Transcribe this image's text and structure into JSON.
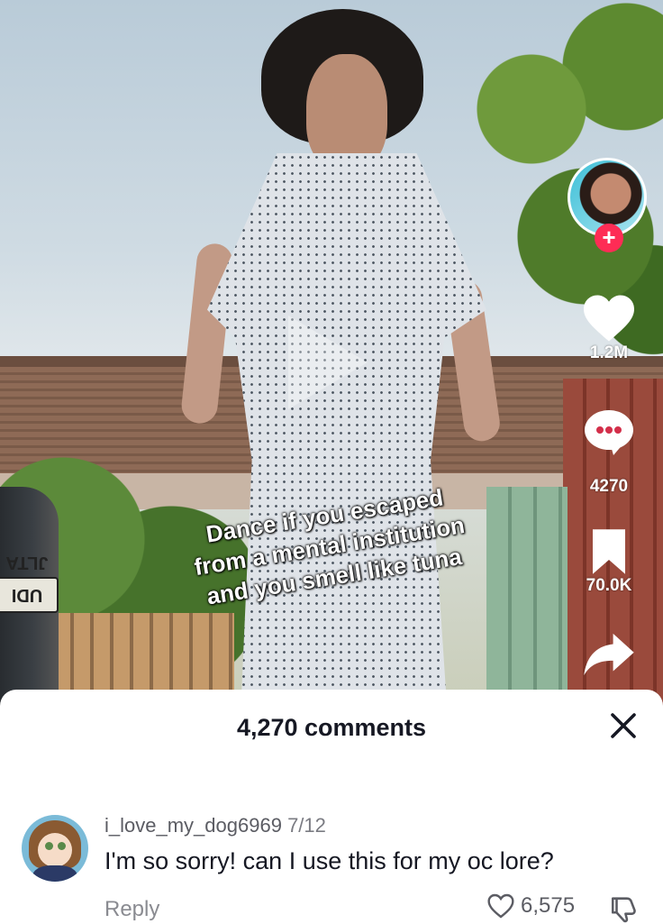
{
  "video": {
    "caption_lines": [
      "Dance if you escaped",
      "from a mental institution",
      "and you smell like tuna"
    ],
    "license_plate": "UDI JLTA",
    "icons": [
      "play-icon"
    ]
  },
  "actions": {
    "follow_label": "+",
    "likes": "1.2M",
    "comments": "4270",
    "bookmarks": "70.0K",
    "icons": [
      "heart-icon",
      "comment-icon",
      "bookmark-icon",
      "share-icon"
    ]
  },
  "comments_sheet": {
    "title": "4,270 comments",
    "close_label": "✕",
    "comment": {
      "username": "i_love_my_dog6969",
      "date": "7/12",
      "text": "I'm so sorry! can I use this for my oc lore?",
      "reply_label": "Reply",
      "like_count": "6,575"
    }
  },
  "colors": {
    "accent": "#fe2c55",
    "sheet_background": "#ffffff",
    "text_primary": "#161823",
    "text_secondary": "#8a8b91"
  }
}
